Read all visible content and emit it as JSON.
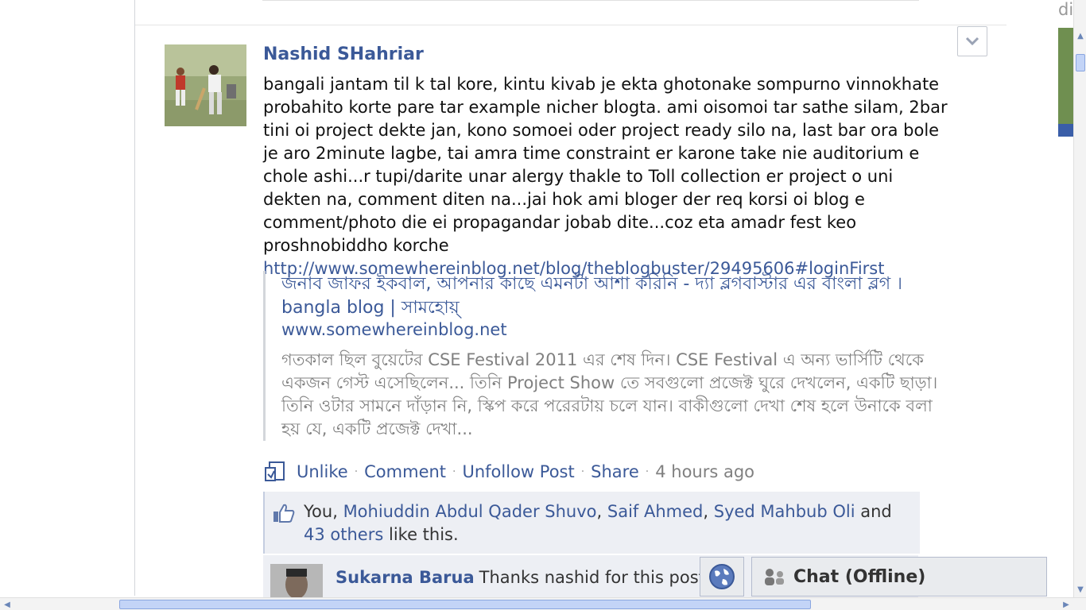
{
  "story": {
    "author": "Nashid SHahriar",
    "message": "bangali jantam til k tal kore, kintu kivab je ekta ghotonake sompurno vinnokhate probahito korte pare tar example nicher blogta. ami oisomoi tar sathe silam, 2bar tini oi project dekte jan, kono somoei oder project ready silo na, last bar ora bole je aro 2minute lagbe, tai amra time constraint er karone take nie auditorium e chole ashi...r tupi/darite unar alergy thakle to Toll collection er project o uni dekten na, comment diten na...jai hok ami bloger der req korsi oi blog e comment/photo die ei propagandar jobab dite...coz eta amadr fest keo proshnobiddho korche",
    "link": "http://www.somewhereinblog.net/blog/theblogbuster/29495606#loginFirst",
    "attachment": {
      "title": "জনাব জাফর ইকবাল, আপনার কাছে এমনটা আশা করিনি - দ্যা ব্লগবাস্টার এর বাংলা ব্লগ । bangla blog | সামহোয়্",
      "domain": "www.somewhereinblog.net",
      "description": "গতকাল ছিল বুয়েটের CSE Festival 2011 এর শেষ দিন। CSE Festival এ অন্য ভার্সিটি থেকে একজন গেস্ট এসেছিলেন... তিনি Project Show তে সবগুলো প্রজেক্ট ঘুরে দেখলেন, একটি ছাড়া। তিনি ওটার সামনে দাঁড়ান নি, স্কিপ করে পরেরটায় চলে যান। বাকীগুলো দেখা শেষ হলে উনাকে বলা হয় যে, একটি প্রজেক্ট দেখা..."
    },
    "actions": {
      "unlike": "Unlike",
      "comment": "Comment",
      "unfollow": "Unfollow Post",
      "share": "Share",
      "timestamp": "4 hours ago"
    },
    "likes": {
      "you": "You,",
      "person1": "Mohiuddin Abdul Qader Shuvo",
      "sep1": ",",
      "person2": "Saif Ahmed",
      "sep2": ",",
      "person3": "Syed Mahbub Oli",
      "and": "and",
      "others": "43 others",
      "suffix": "like this."
    },
    "comment": {
      "author": "Sukarna Barua",
      "text": "Thanks nashid for this post.",
      "text_overflow": "nl"
    }
  },
  "chat": {
    "label": "Chat (Offline)"
  },
  "right_column": {
    "partial_text": "di"
  },
  "icons": {
    "chevron": "chevron-down-icon",
    "unlike": "unlike-icon",
    "thumb": "thumbs-up-icon",
    "globe": "globe-icon",
    "chat": "chat-users-icon"
  }
}
